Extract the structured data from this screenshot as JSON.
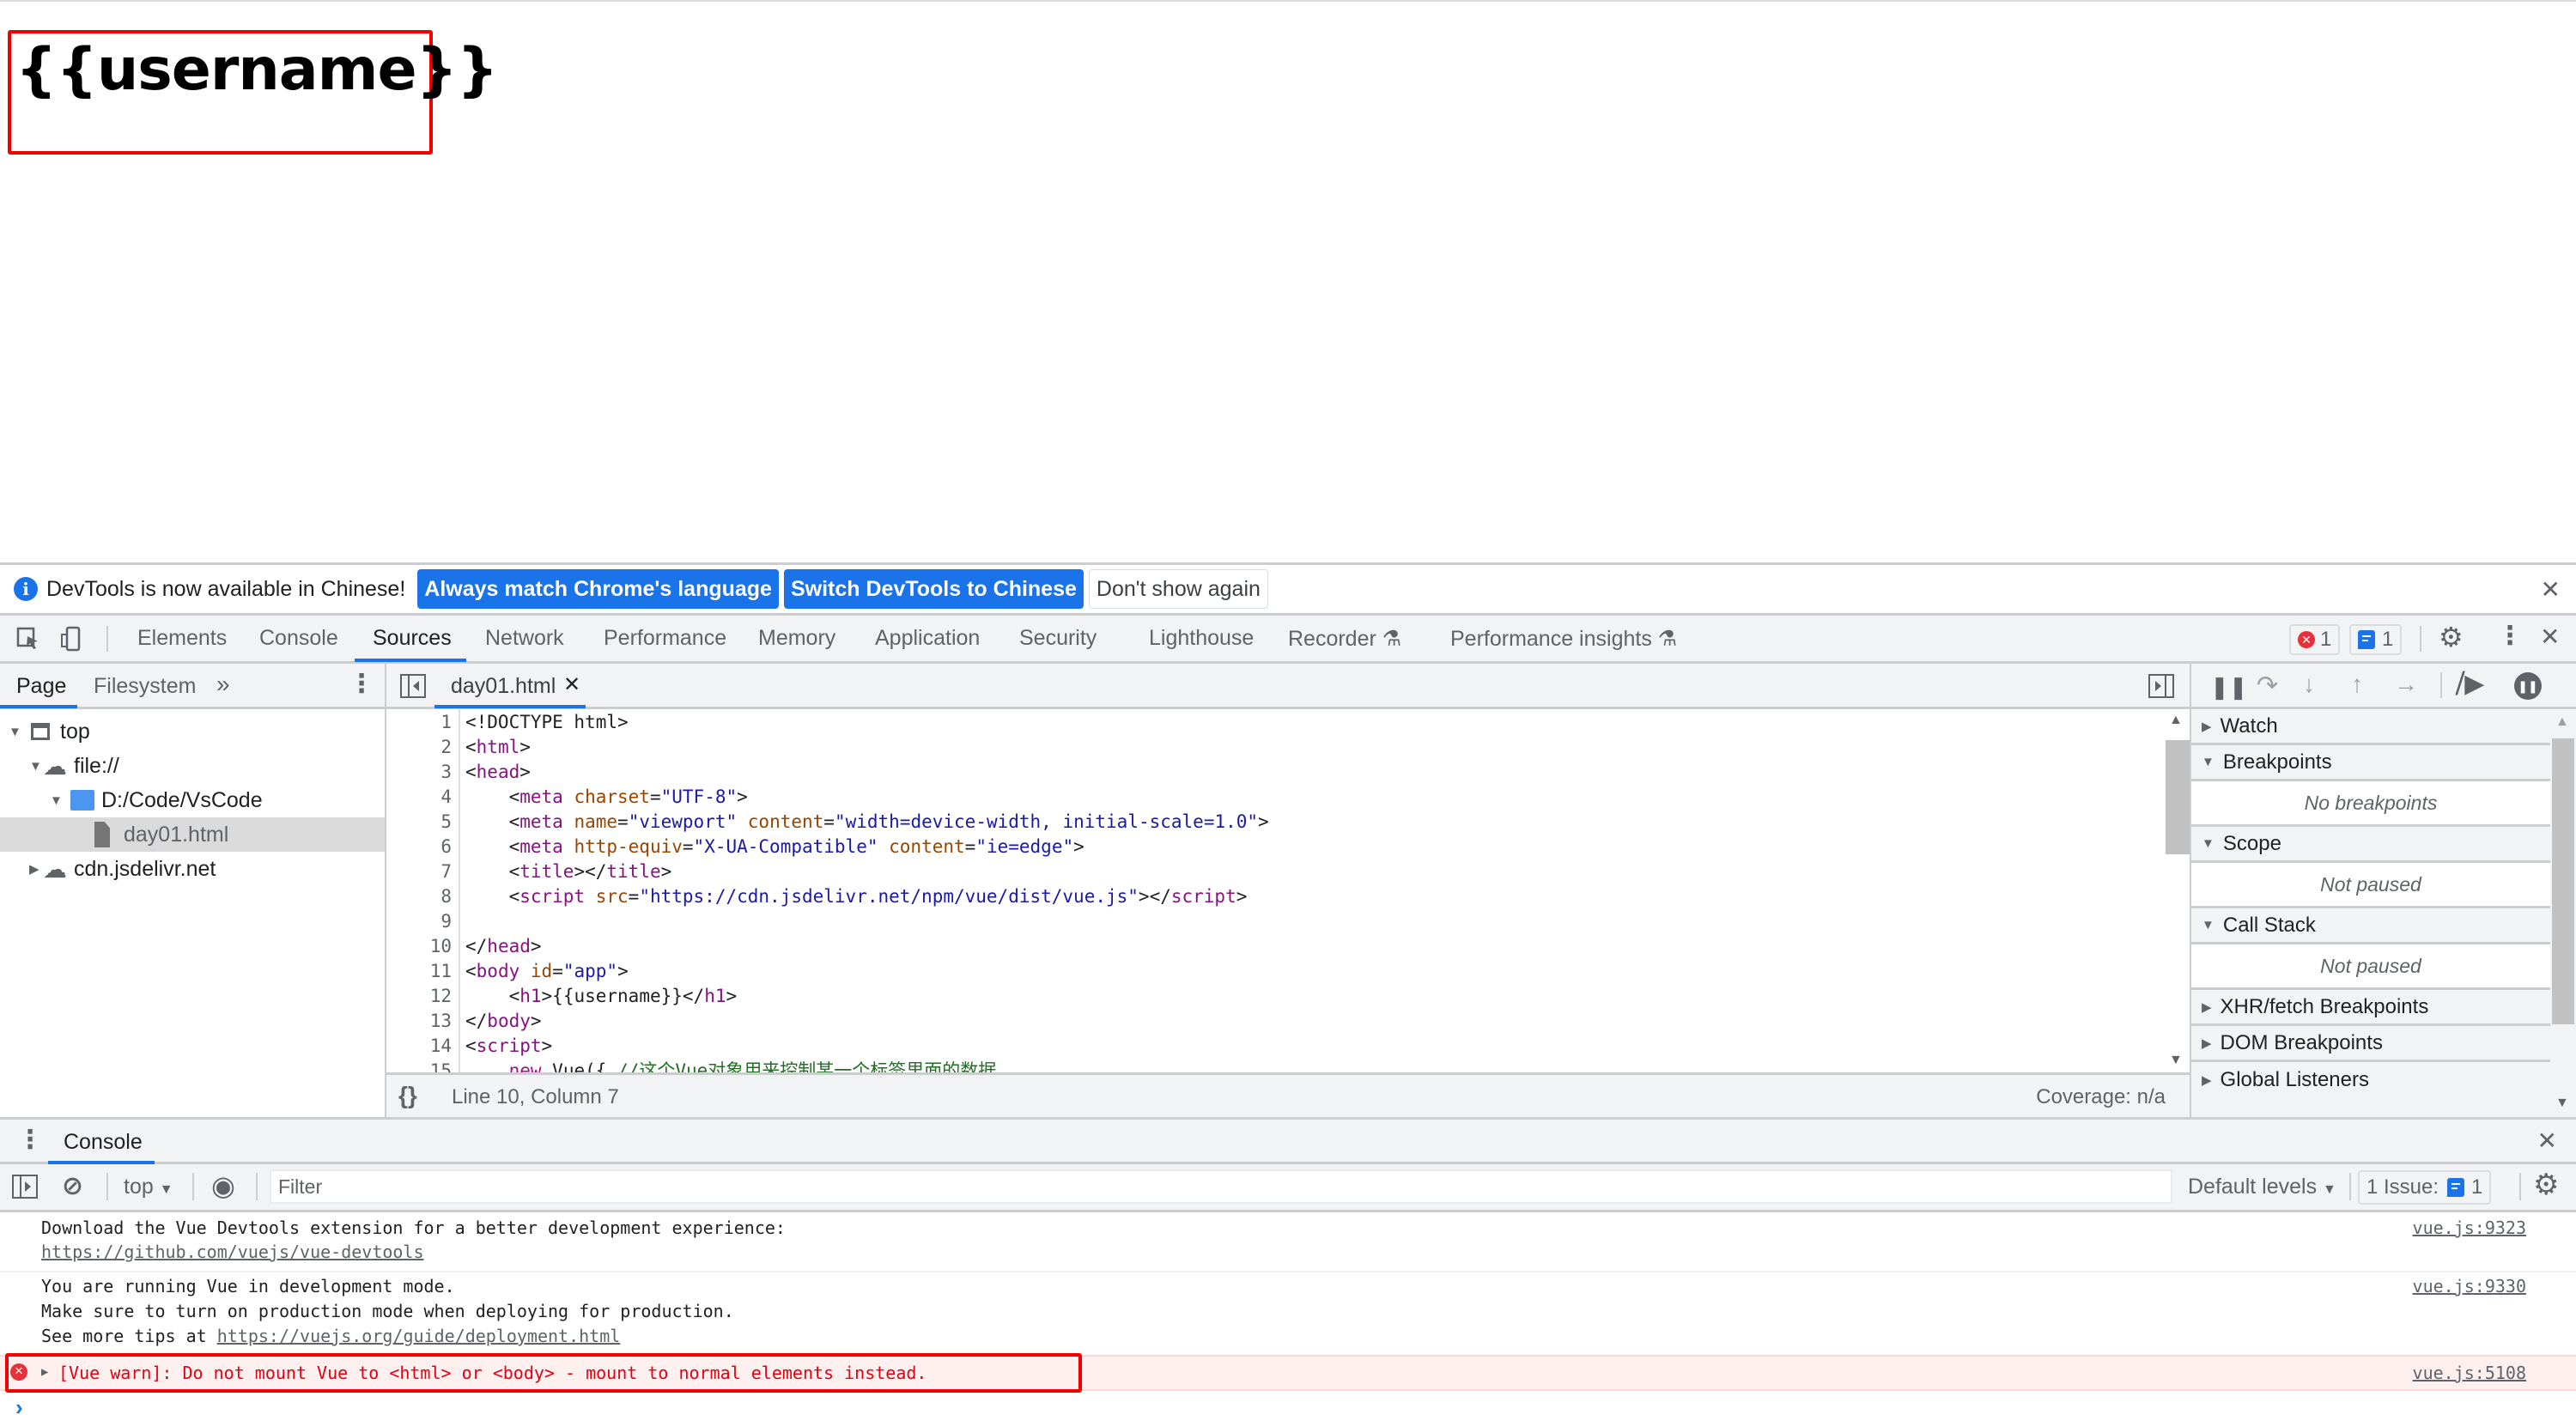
{
  "page": {
    "heading": "{{username}}"
  },
  "infobar": {
    "message": "DevTools is now available in Chinese!",
    "btn_match": "Always match Chrome's language",
    "btn_switch": "Switch DevTools to Chinese",
    "btn_dont_show": "Don't show again"
  },
  "main_tabs": [
    {
      "label": "Elements"
    },
    {
      "label": "Console"
    },
    {
      "label": "Sources"
    },
    {
      "label": "Network"
    },
    {
      "label": "Performance"
    },
    {
      "label": "Memory"
    },
    {
      "label": "Application"
    },
    {
      "label": "Security"
    },
    {
      "label": "Lighthouse"
    },
    {
      "label": "Recorder"
    },
    {
      "label": "Performance insights"
    }
  ],
  "active_tab": "Sources",
  "counts": {
    "errors": "1",
    "messages": "1"
  },
  "navigator": {
    "tabs": [
      "Page",
      "Filesystem"
    ],
    "more": "»",
    "tree": [
      {
        "label": "top"
      },
      {
        "label": "file://"
      },
      {
        "label": "D:/Code/VsCode"
      },
      {
        "label": "day01.html"
      },
      {
        "label": "cdn.jsdelivr.net"
      }
    ]
  },
  "editor": {
    "open_file": "day01.html",
    "lines": [
      {
        "n": "1"
      },
      {
        "n": "2"
      },
      {
        "n": "3"
      },
      {
        "n": "4"
      },
      {
        "n": "5"
      },
      {
        "n": "6"
      },
      {
        "n": "7"
      },
      {
        "n": "8"
      },
      {
        "n": "9"
      },
      {
        "n": "10"
      },
      {
        "n": "11"
      },
      {
        "n": "12"
      },
      {
        "n": "13"
      },
      {
        "n": "14"
      },
      {
        "n": "15"
      }
    ],
    "code": {
      "l1": "<!DOCTYPE html>",
      "l2_tag": "html",
      "l3_tag": "head",
      "l4_val": "\"UTF-8\"",
      "l5_name": "\"viewport\"",
      "l5_content": "\"width=device-width, initial-scale=1.0\"",
      "l6_equiv": "\"X-UA-Compatible\"",
      "l6_content": "\"ie=edge\"",
      "l8_src": "\"https://cdn.jsdelivr.net/npm/vue/dist/vue.js\"",
      "l11_id": "\"app\"",
      "l12_text": "{{username}}",
      "l15_code": "Vue({ ",
      "l15_comment": "//这个Vue对象用来控制某一个标签里面的数据"
    },
    "status_position": "Line 10, Column 7",
    "coverage": "Coverage: n/a"
  },
  "debugger": {
    "panes": [
      {
        "label": "Watch",
        "expanded": false
      },
      {
        "label": "Breakpoints",
        "expanded": true,
        "body": "No breakpoints"
      },
      {
        "label": "Scope",
        "expanded": true,
        "body": "Not paused"
      },
      {
        "label": "Call Stack",
        "expanded": true,
        "body": "Not paused"
      },
      {
        "label": "XHR/fetch Breakpoints",
        "expanded": false
      },
      {
        "label": "DOM Breakpoints",
        "expanded": false
      },
      {
        "label": "Global Listeners",
        "expanded": false
      }
    ]
  },
  "drawer": {
    "tab": "Console",
    "context": "top",
    "filter_placeholder": "Filter",
    "levels": "Default levels",
    "issues_label": "1 Issue:",
    "issues_count": "1"
  },
  "console_messages": [
    {
      "lines": [
        "Download the Vue Devtools extension for a better development experience:"
      ],
      "link": "https://github.com/vuejs/vue-devtools",
      "source": "vue.js:9323"
    },
    {
      "lines": [
        "You are running Vue in development mode.",
        "Make sure to turn on production mode when deploying for production."
      ],
      "prefix": "See more tips at ",
      "link": "https://vuejs.org/guide/deployment.html",
      "source": "vue.js:9330"
    },
    {
      "level": "error",
      "text": "[Vue warn]: Do not mount Vue to <html> or <body> - mount to normal elements instead.",
      "source": "vue.js:5108"
    }
  ],
  "colors": {
    "accent": "#1a73e8",
    "error": "#e8303a",
    "highlight_box": "#f20000"
  }
}
